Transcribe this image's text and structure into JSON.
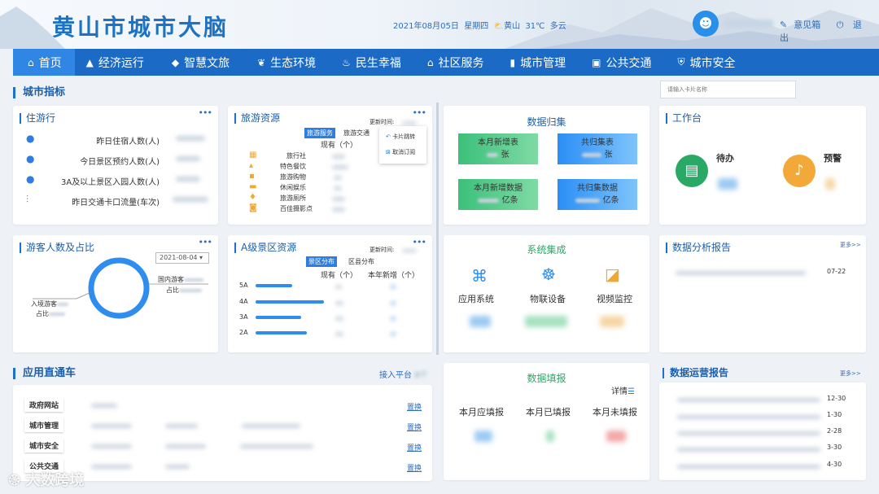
{
  "header": {
    "title": "黄山市城市大脑",
    "date": "2021年08月05日",
    "weekday": "星期四",
    "location": "黄山",
    "temperature": "31℃",
    "weather": "多云",
    "feedback": "意见箱",
    "logout": "退出"
  },
  "nav": [
    "首页",
    "经济运行",
    "智慧文旅",
    "生态环境",
    "民生幸福",
    "社区服务",
    "城市管理",
    "公共交通",
    "城市安全"
  ],
  "sections": {
    "city_index": "城市指标",
    "app_express": "应用直通车",
    "search_placeholder": "请输入卡片名称",
    "access_platform": "接入平台",
    "access_count": "8个"
  },
  "lodging": {
    "title": "住游行",
    "rows": [
      "昨日住宿人数(人)",
      "今日景区预约人数(人)",
      "3A及以上景区入园人数(人)",
      "昨日交通卡口流量(车次)"
    ]
  },
  "tourism_resources": {
    "title": "旅游资源",
    "update": "更新时间:",
    "tabs": [
      "旅游服务",
      "旅游交通"
    ],
    "col": "现有（个）",
    "rows": [
      "旅行社",
      "特色餐饮",
      "旅游购物",
      "休闲娱乐",
      "旅游厕所",
      "百佳摄影点"
    ],
    "menu": [
      "卡片跳转",
      "取消订阅"
    ]
  },
  "visitors": {
    "title": "游客人数及占比",
    "date": "2021-08-04",
    "inbound": "入境游客",
    "ratio": "占比",
    "domestic": "国内游客",
    "ratio2": "占比"
  },
  "a_scenic": {
    "title": "A级景区资源",
    "update": "更新时间:",
    "tabs": [
      "景区分布",
      "区县分布"
    ],
    "cols": [
      "现有（个）",
      "本年新增（个）"
    ],
    "levels": [
      "5A",
      "4A",
      "3A",
      "2A"
    ],
    "bars": [
      0.32,
      0.6,
      0.4,
      0.45
    ]
  },
  "data_collect": {
    "title": "数据归集",
    "items": [
      {
        "label": "本月新增表",
        "unit": "张"
      },
      {
        "label": "共归集表",
        "unit": "张"
      },
      {
        "label": "本月新增数据",
        "unit": "亿条"
      },
      {
        "label": "共归集数据",
        "unit": "亿条"
      }
    ]
  },
  "system_integration": {
    "title": "系统集成",
    "items": [
      "应用系统",
      "物联设备",
      "视频监控"
    ]
  },
  "data_report": {
    "title": "数据填报",
    "detail": "详情",
    "items": [
      "本月应填报",
      "本月已填报",
      "本月未填报"
    ]
  },
  "workbench": {
    "title": "工作台",
    "todo": "待办",
    "warning": "预警"
  },
  "analysis_report": {
    "title": "数据分析报告",
    "more": "更多>>",
    "date": "07-22"
  },
  "operation_report": {
    "title": "数据运营报告",
    "more": "更多>>",
    "dates": [
      "12-30",
      "1-30",
      "2-28",
      "3-30",
      "4-30"
    ]
  },
  "app_list": {
    "items": [
      "政府网站",
      "城市管理",
      "城市安全",
      "公共交通"
    ],
    "link": "置换"
  },
  "watermark": "大数跨境"
}
